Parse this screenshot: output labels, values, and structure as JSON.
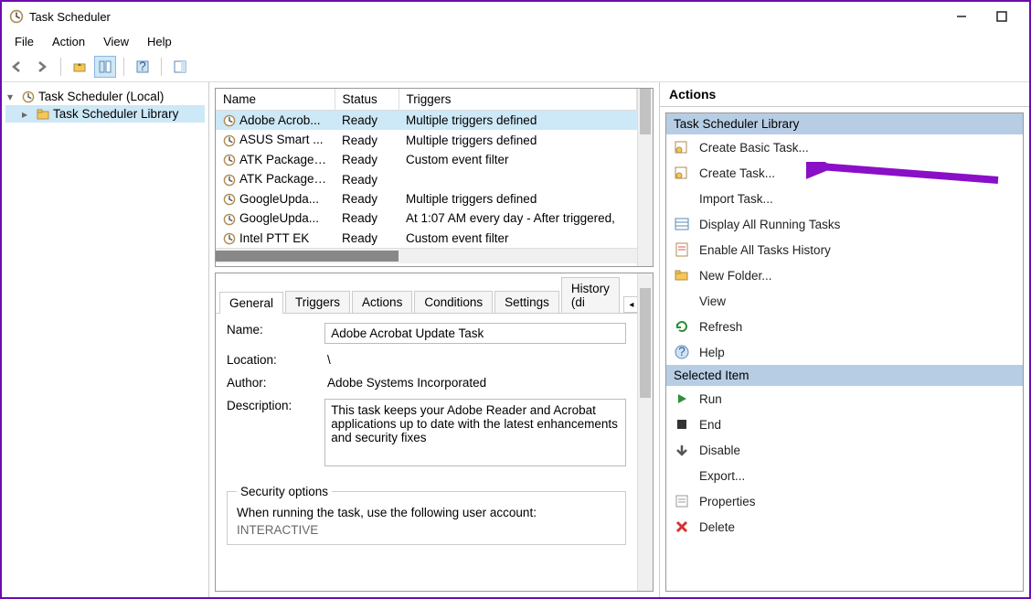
{
  "window": {
    "title": "Task Scheduler"
  },
  "menus": {
    "file": "File",
    "action": "Action",
    "view": "View",
    "help": "Help"
  },
  "tree": {
    "root": "Task Scheduler (Local)",
    "library": "Task Scheduler Library"
  },
  "task_table": {
    "columns": {
      "name": "Name",
      "status": "Status",
      "triggers": "Triggers"
    },
    "rows": [
      {
        "name": "Adobe Acrob...",
        "status": "Ready",
        "triggers": "Multiple triggers defined",
        "selected": true
      },
      {
        "name": "ASUS Smart ...",
        "status": "Ready",
        "triggers": "Multiple triggers defined"
      },
      {
        "name": "ATK Package ...",
        "status": "Ready",
        "triggers": "Custom event filter"
      },
      {
        "name": "ATK Package ...",
        "status": "Ready",
        "triggers": ""
      },
      {
        "name": "GoogleUpda...",
        "status": "Ready",
        "triggers": "Multiple triggers defined"
      },
      {
        "name": "GoogleUpda...",
        "status": "Ready",
        "triggers": "At 1:07 AM every day - After triggered,"
      },
      {
        "name": "Intel PTT EK",
        "status": "Ready",
        "triggers": "Custom event filter"
      }
    ]
  },
  "tabs": {
    "general": "General",
    "triggers": "Triggers",
    "actions": "Actions",
    "conditions": "Conditions",
    "settings": "Settings",
    "history": "History (di"
  },
  "general": {
    "name_label": "Name:",
    "name_value": "Adobe Acrobat Update Task",
    "location_label": "Location:",
    "location_value": "\\",
    "author_label": "Author:",
    "author_value": "Adobe Systems Incorporated",
    "description_label": "Description:",
    "description_value": "This task keeps your Adobe Reader and Acrobat applications up to date with the latest enhancements and security fixes",
    "security_legend": "Security options",
    "security_text": "When running the task, use the following user account:",
    "security_account": "INTERACTIVE"
  },
  "actions": {
    "header": "Actions",
    "section_library": "Task Scheduler Library",
    "library_items": {
      "create_basic": "Create Basic Task...",
      "create_task": "Create Task...",
      "import": "Import Task...",
      "display_running": "Display All Running Tasks",
      "enable_history": "Enable All Tasks History",
      "new_folder": "New Folder...",
      "view": "View",
      "refresh": "Refresh",
      "help": "Help"
    },
    "section_selected": "Selected Item",
    "selected_items": {
      "run": "Run",
      "end": "End",
      "disable": "Disable",
      "export": "Export...",
      "properties": "Properties",
      "delete": "Delete"
    }
  }
}
